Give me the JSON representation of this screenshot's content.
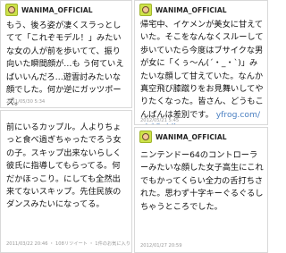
{
  "tweets": [
    {
      "username": "WANIMA_OFFICIAL",
      "text": "もう、後ろ姿が凄くスラっとしてて「これぞモデル！」みたいな女の人が前を歩いてて、振り向いた瞬間顔が…も う何ていえばいいんだろ…遊雲討みたいな顔でした。何か逆にガッツポーズ。",
      "meta": "2011/05/30 5:34"
    },
    {
      "username": "WANIMA_OFFICIAL",
      "text": "前にいるカップル。人よりちょっと食べ過ぎちゃったでろう女の子。スキップ出来ないらしく彼氏に指導してもらってる。何だかほっこり。にしても全然出来てないスキップ。先住民族のダンスみたいになってる。",
      "meta": "2011/03/22 20:46  ・ 108リツイート  ・ 1件のお気に入り"
    },
    {
      "username": "WANIMA_OFFICIAL",
      "text": "帰宅中、イケメンが美女に甘えていた。そこをなんなくスルーして歩いていたら今度はブサイクな男が女に「くぅ〜ん(´・_・`)」みたいな顔して甘えていた。なんか真空飛び膝蹴りをお見舞いしてやりたくなった。皆さん、どうもこんばんは差別です。",
      "link": "yfrog.com/ob15ubjj",
      "meta": "2012/05/21 5:45"
    },
    {
      "username": "WANIMA_OFFICIAL",
      "text": "ニンテンドー64のコントローラーみたいな顔した女子高生にこれでもかってくらい全力の舌打ちされた。思わず十字キーぐるぐるしちゃうところでした。",
      "meta": "2012/01/27 20:59"
    }
  ]
}
